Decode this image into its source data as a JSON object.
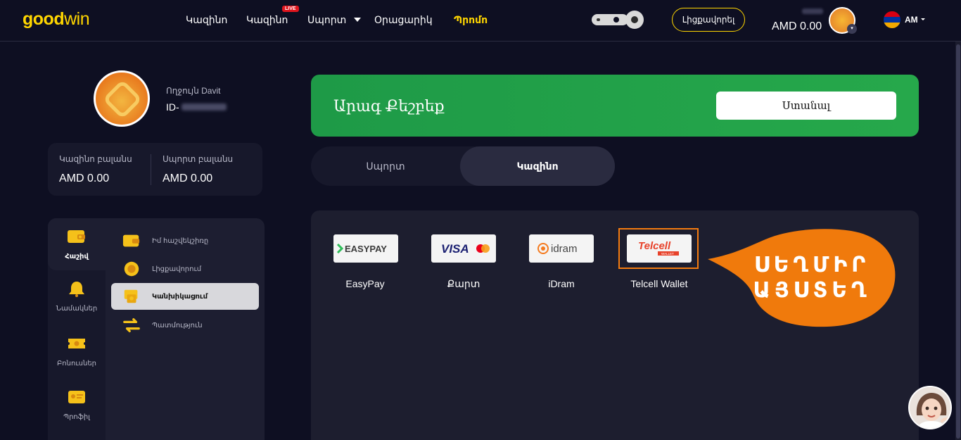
{
  "header": {
    "logo_good": "good",
    "logo_win": "win",
    "nav": [
      {
        "label": "Կազինո"
      },
      {
        "label": "Կազինո",
        "badge": "LIVE"
      },
      {
        "label": "Սպորտ"
      },
      {
        "label": "Օրացարիկ"
      },
      {
        "label": "Պրոմո"
      }
    ],
    "deposit_label": "Լիցքավորել",
    "balance": "AMD 0.00",
    "username_blurred": "Davit",
    "language": "AM"
  },
  "profile": {
    "greeting": "Ողջույն Davit",
    "id_prefix": "ID-",
    "casino_balance_label": "Կազինո բալանս",
    "casino_balance_value": "AMD 0.00",
    "sport_balance_label": "Սպորտ բալանս",
    "sport_balance_value": "AMD 0.00"
  },
  "side_menu": {
    "icons": [
      {
        "label": "Հաշիվ",
        "icon": "wallet-icon",
        "active": true
      },
      {
        "label": "Նամակներ",
        "icon": "bell-icon"
      },
      {
        "label": "Բոնուսներ",
        "icon": "ticket-icon"
      },
      {
        "label": "Պրոֆիլ",
        "icon": "id-card-icon"
      }
    ],
    "sub_items": [
      {
        "label": "Իմ հաշվեկշիռը",
        "icon": "wallet-icon"
      },
      {
        "label": "Լիցքավորում",
        "icon": "coin-icon"
      },
      {
        "label": "Կանխիկացում",
        "icon": "cash-out-icon",
        "active": true
      },
      {
        "label": "Պատմություն",
        "icon": "arrows-icon"
      }
    ]
  },
  "banner": {
    "text": "Արագ Քեշբեք",
    "button_label": "Ստանալ"
  },
  "tabs": {
    "sport": "Սպորտ",
    "casino": "Կազինո"
  },
  "payments": [
    {
      "name": "EasyPay",
      "logo_text": "EASYPAY"
    },
    {
      "name": "Քարտ",
      "logo_text": "VISA"
    },
    {
      "name": "iDram",
      "logo_text": "idram"
    },
    {
      "name": "Telcell Wallet",
      "logo_text": "Telcell",
      "logo_sub": "WALLET"
    }
  ],
  "callout": {
    "line1": "ՍԵՂՄԻՐ",
    "line2": "ԱՅՍՏԵՂ",
    "color": "#f07a0c"
  },
  "colors": {
    "brand": "#ffd600",
    "banner": "#26a84b",
    "background": "#0e0f22"
  }
}
